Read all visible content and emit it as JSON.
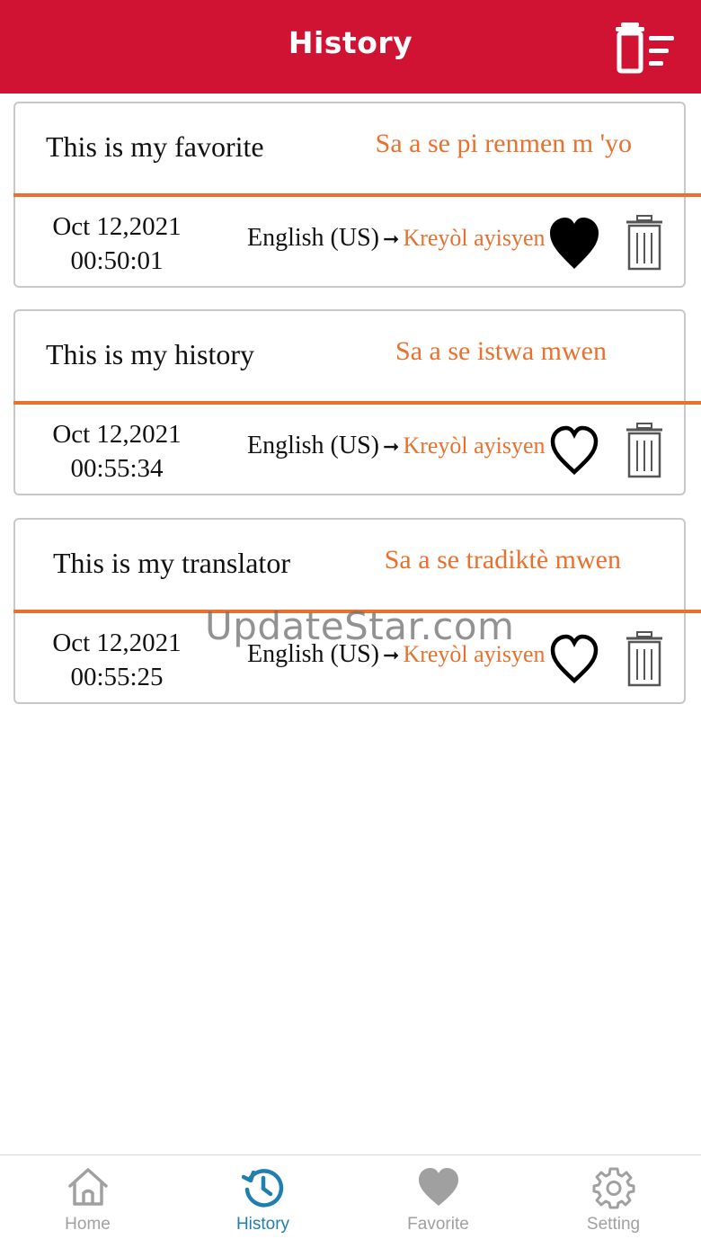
{
  "header": {
    "title": "History",
    "clear_icon": "clear-history-icon"
  },
  "colors": {
    "header_bg": "#d01233",
    "accent": "#e9702d",
    "active_tab": "#1e7fb0",
    "inactive_tab": "#a0a0a0"
  },
  "entries": [
    {
      "source": "This is my favorite",
      "translation": "Sa a se pi renmen m 'yo",
      "date": "Oct 12,2021",
      "time": "00:50:01",
      "from_lang": "English (US)",
      "arrow": "➞",
      "to_lang": "Kreyòl ayisyen",
      "favorite": true
    },
    {
      "source": "This is my history",
      "translation": "Sa a se istwa mwen",
      "date": "Oct 12,2021",
      "time": "00:55:34",
      "from_lang": "English (US)",
      "arrow": "➞",
      "to_lang": "Kreyòl ayisyen",
      "favorite": false
    },
    {
      "source": "This is my translator",
      "translation": "Sa a se tradiktè mwen",
      "date": "Oct 12,2021",
      "time": "00:55:25",
      "from_lang": "English (US)",
      "arrow": "➞",
      "to_lang": "Kreyòl ayisyen",
      "favorite": false
    }
  ],
  "watermark": "UpdateStar.com",
  "tabs": [
    {
      "label": "Home",
      "icon": "home-icon",
      "active": false
    },
    {
      "label": "History",
      "icon": "history-icon",
      "active": true
    },
    {
      "label": "Favorite",
      "icon": "heart-icon",
      "active": false
    },
    {
      "label": "Setting",
      "icon": "gear-icon",
      "active": false
    }
  ]
}
